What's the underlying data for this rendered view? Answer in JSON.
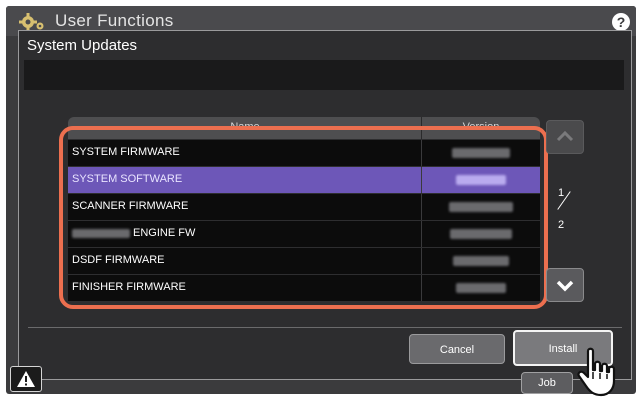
{
  "background": {
    "title": "User Functions",
    "help_label": "?"
  },
  "dialog": {
    "title": "System Updates",
    "table": {
      "columns": [
        "Name",
        "Version"
      ],
      "rows": [
        {
          "name": "SYSTEM FIRMWARE",
          "name_prefix_blurred": false,
          "version_blurred": true,
          "selected": false
        },
        {
          "name": "SYSTEM SOFTWARE",
          "name_prefix_blurred": false,
          "version_blurred": true,
          "selected": true
        },
        {
          "name": "SCANNER FIRMWARE",
          "name_prefix_blurred": false,
          "version_blurred": true,
          "selected": false
        },
        {
          "name": "ENGINE FW",
          "name_prefix_blurred": true,
          "version_blurred": true,
          "selected": false
        },
        {
          "name": "DSDF FIRMWARE",
          "name_prefix_blurred": false,
          "version_blurred": true,
          "selected": false
        },
        {
          "name": "FINISHER FIRMWARE",
          "name_prefix_blurred": false,
          "version_blurred": true,
          "selected": false
        }
      ]
    },
    "pager": {
      "current": "1",
      "total": "2"
    },
    "buttons": {
      "cancel": "Cancel",
      "install": "Install"
    }
  },
  "footer": {
    "job_label": "Job"
  },
  "colors": {
    "accent_selected": "#6d57b8",
    "highlight_outline": "#ec6f4f"
  },
  "icons": [
    "gear-icon",
    "help-icon",
    "chevron-up-icon",
    "chevron-down-icon",
    "warning-icon",
    "pointing-hand-icon"
  ]
}
